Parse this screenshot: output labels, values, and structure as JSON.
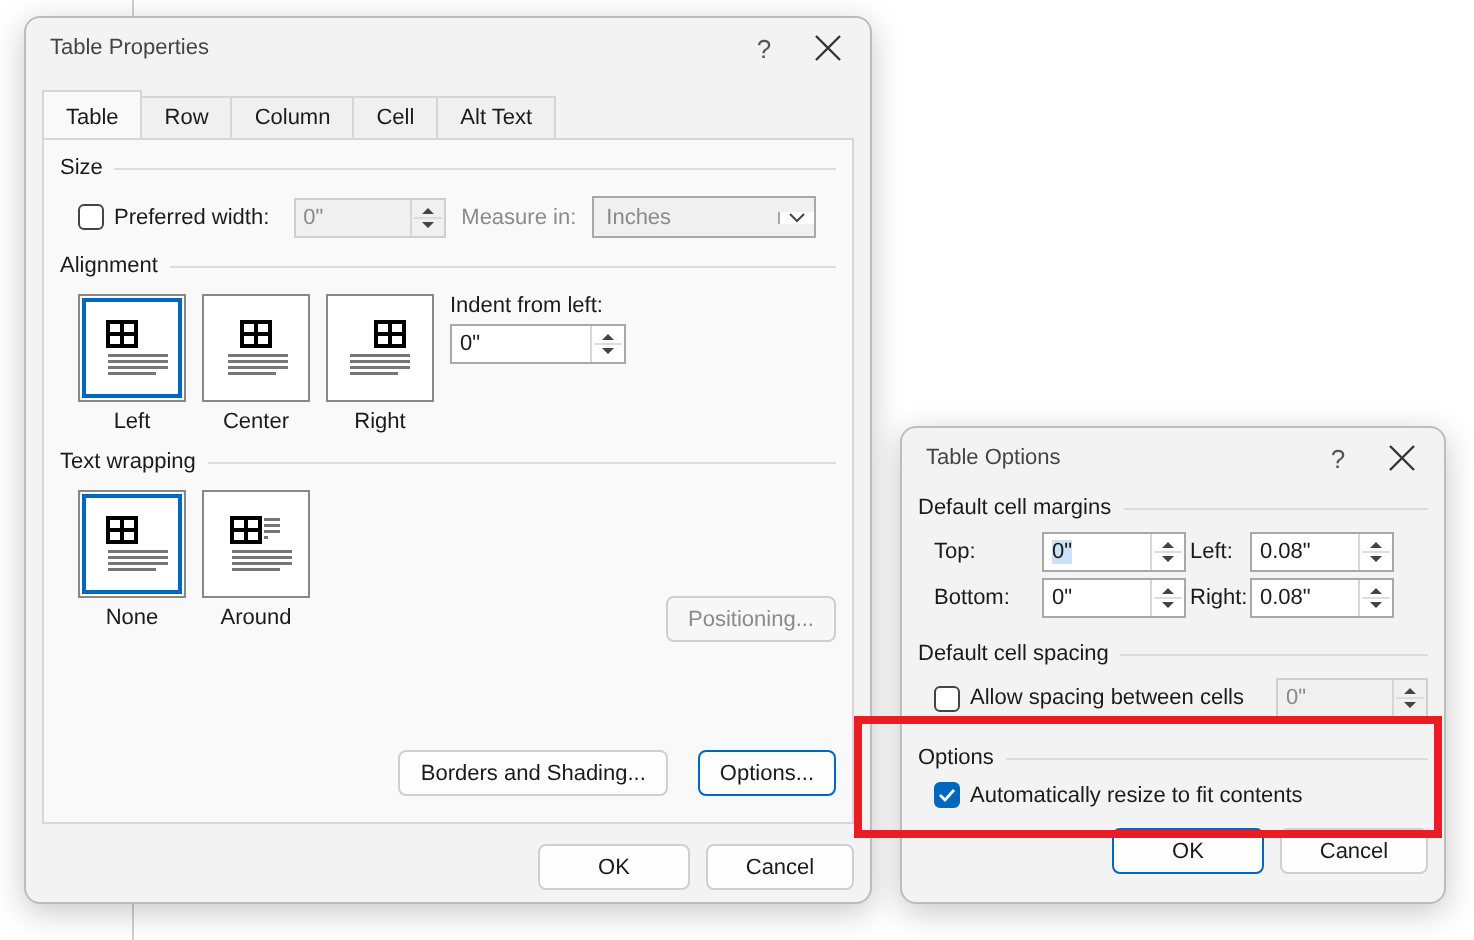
{
  "table_properties": {
    "title": "Table Properties",
    "help": "?",
    "tabs": [
      {
        "label": "Table",
        "selected": true
      },
      {
        "label": "Row",
        "selected": false
      },
      {
        "label": "Column",
        "selected": false
      },
      {
        "label": "Cell",
        "selected": false
      },
      {
        "label": "Alt Text",
        "selected": false
      }
    ],
    "size": {
      "heading": "Size",
      "preferred_width": {
        "label": "Preferred width:",
        "checked": false,
        "value": "0\"",
        "disabled": true
      },
      "measure_in": {
        "label": "Measure in:",
        "value": "Inches",
        "disabled": true
      }
    },
    "alignment": {
      "heading": "Alignment",
      "options": [
        {
          "kind": "left",
          "label": "Left",
          "selected": true
        },
        {
          "kind": "center",
          "label": "Center",
          "selected": false
        },
        {
          "kind": "right",
          "label": "Right",
          "selected": false
        }
      ],
      "indent": {
        "label": "Indent from left:",
        "value": "0\""
      }
    },
    "text_wrapping": {
      "heading": "Text wrapping",
      "options": [
        {
          "kind": "none",
          "label": "None",
          "selected": true
        },
        {
          "kind": "around",
          "label": "Around",
          "selected": false
        }
      ],
      "positioning": {
        "label": "Positioning...",
        "disabled": true
      }
    },
    "panel_buttons": [
      {
        "label": "Borders and Shading...",
        "focused": false
      },
      {
        "label": "Options...",
        "focused": true
      }
    ],
    "buttons": [
      {
        "label": "OK",
        "default": false
      },
      {
        "label": "Cancel",
        "default": false
      }
    ]
  },
  "table_options": {
    "title": "Table Options",
    "help": "?",
    "margins": {
      "heading": "Default cell margins",
      "fields": [
        {
          "label": "Top:",
          "value": "0\"",
          "highlighted": true
        },
        {
          "label": "Left:",
          "value": "0.08\"",
          "highlighted": false
        },
        {
          "label": "Bottom:",
          "value": "0\"",
          "highlighted": false
        },
        {
          "label": "Right:",
          "value": "0.08\"",
          "highlighted": false
        }
      ]
    },
    "spacing": {
      "heading": "Default cell spacing",
      "checkbox": {
        "label": "Allow spacing between cells",
        "checked": false
      },
      "field": {
        "value": "0\"",
        "disabled": true
      }
    },
    "options": {
      "heading": "Options",
      "checkbox": {
        "label": "Automatically resize to fit contents",
        "checked": true
      }
    },
    "buttons": [
      {
        "label": "OK",
        "default": true
      },
      {
        "label": "Cancel",
        "default": false
      }
    ]
  }
}
